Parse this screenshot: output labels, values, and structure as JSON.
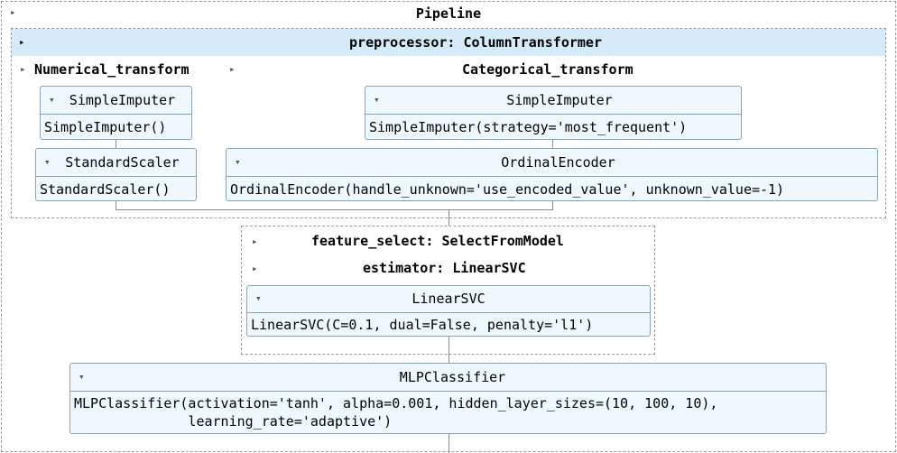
{
  "pipeline": {
    "label": "Pipeline"
  },
  "preprocessor": {
    "label": "preprocessor: ColumnTransformer",
    "numerical": {
      "label": "Numerical_transform",
      "imputer": {
        "title": "SimpleImputer",
        "params": "SimpleImputer()"
      },
      "scaler": {
        "title": "StandardScaler",
        "params": "StandardScaler()"
      }
    },
    "categorical": {
      "label": "Categorical_transform",
      "imputer": {
        "title": "SimpleImputer",
        "params": "SimpleImputer(strategy='most_frequent')"
      },
      "encoder": {
        "title": "OrdinalEncoder",
        "params": "OrdinalEncoder(handle_unknown='use_encoded_value', unknown_value=-1)"
      }
    }
  },
  "feature_select": {
    "label": "feature_select: SelectFromModel",
    "estimator_label": "estimator: LinearSVC",
    "linearsvc": {
      "title": "LinearSVC",
      "params": "LinearSVC(C=0.1, dual=False, penalty='l1')"
    }
  },
  "classifier": {
    "title": "MLPClassifier",
    "params_line1": "MLPClassifier(activation='tanh', alpha=0.001, hidden_layer_sizes=(10, 100, 10),",
    "params_line2": "              learning_rate='adaptive')"
  },
  "icons": {
    "collapsed": "▸",
    "expanded": "▾"
  }
}
